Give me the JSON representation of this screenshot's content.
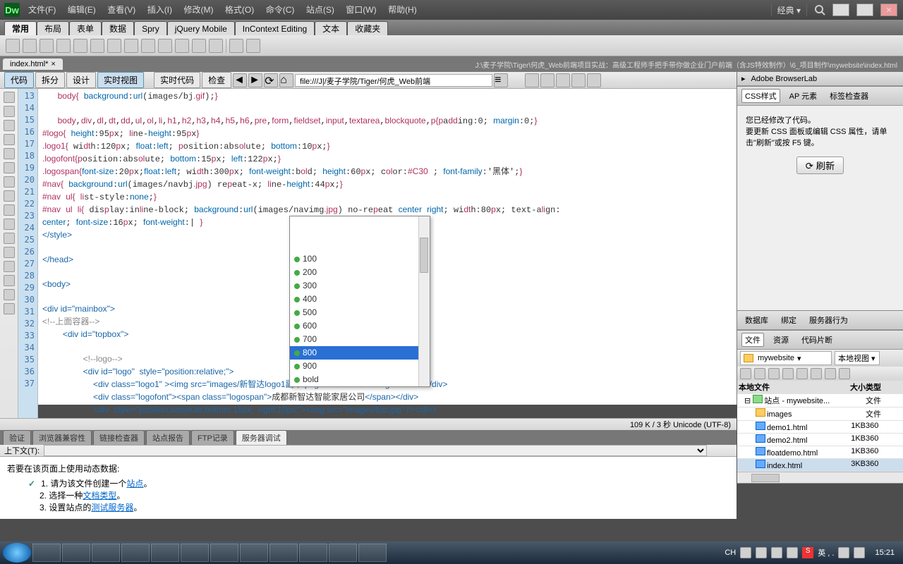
{
  "app": {
    "logo": "Dw",
    "layout_label": "经典"
  },
  "menubar": [
    "文件(F)",
    "编辑(E)",
    "查看(V)",
    "插入(I)",
    "修改(M)",
    "格式(O)",
    "命令(C)",
    "站点(S)",
    "窗口(W)",
    "帮助(H)"
  ],
  "insert_tabs": [
    "常用",
    "布局",
    "表单",
    "数据",
    "Spry",
    "jQuery Mobile",
    "InContext Editing",
    "文本",
    "收藏夹"
  ],
  "file_tab": {
    "name": "index.html*",
    "close": "×",
    "path": "J:\\麦子学院\\Tiger\\何虎_Web前端项目实战：高级工程师手把手带你做企业门户前端（含JS特效制作）\\6_项目制作\\mywebsite\\index.html"
  },
  "view_buttons": {
    "code": "代码",
    "split": "拆分",
    "design": "设计",
    "live": "实时视图",
    "livecode": "实时代码",
    "check": "检查"
  },
  "addr_prefix": "file:///J|/麦子学院/Tiger/何虎_Web前端",
  "code_lines": {
    "start": 13,
    "end": 37,
    "l13": "body{ background:url(images/bj.gif);}",
    "l14": "",
    "l15": "body,div,dl,dt,dd,ul,ol,li,h1,h2,h3,h4,h5,h6,pre,form,fieldset,input,textarea,blockquote,p{padding:0; margin:0;}",
    "l16": "#logo{ height:95px; line-height:95px}",
    "l17": ".logo1{ width:120px; float:left; position:absolute; bottom:10px;}",
    "l18": ".logofont{position:absolute; bottom:15px; left:122px;}",
    "l19": ".logospan{font-size:20px;float:left; width:300px; font-weight:bold; height:60px; color:#C30 ; font-family:'黑体';}",
    "l20": "#nav{ background:url(images/navbj.jpg) repeat-x; line-height:44px;}",
    "l21": "#nav ul{ list-style:none;}",
    "l22a": "#nav ul li{ display:inline-block; background:url(images/navimg.jpg) no-repeat center right; width:80px; text-align:",
    "l22b": "center; font-size:16px; font-weight:| }",
    "l23": "</style>",
    "l24": "",
    "l25": "</head>",
    "l26": "",
    "l27": "<body>",
    "l28": "",
    "l29": "<div id=\"mainbox\">",
    "l30": "<!--上面容器-->",
    "l31": "    <div id=\"topbox\">",
    "l32": "",
    "l33": "        <!--logo-->",
    "l34": "        <div id=\"logo\"  style=\"position:relative;\">",
    "l35": "          <div class=\"logo1\" ><img src=\"images/新智达logo1副本.png\"  width=\"120\" height=\"60\"/></div>",
    "l36": "          <div class=\"logofont\"><span class=\"logospan\">成都新智达智能家居公司</span></div>",
    "l37": "          <div  style=\"position:absolute;bottom:15px;  right:10px;\"><img src=\"images/top.jpg\" /></div>"
  },
  "autocomplete": {
    "options": [
      "100",
      "200",
      "300",
      "400",
      "500",
      "600",
      "700",
      "800",
      "900",
      "bold"
    ],
    "selected": "800"
  },
  "status": "109 K / 3 秒 Unicode (UTF-8)",
  "bottom_tabs": [
    "验证",
    "浏览器兼容性",
    "链接检查器",
    "站点报告",
    "FTP记录",
    "服务器调试"
  ],
  "context_label": "上下文(T):",
  "dynamic": {
    "intro": "若要在该页面上使用动态数据:",
    "s1": "请为该文件创建一个",
    "s1link": "站点",
    "s2": "选择一种",
    "s2link": "文档类型",
    "s3": "设置站点的",
    "s3link": "测试服务器"
  },
  "right": {
    "browserlab_title": "Adobe BrowserLab",
    "css_tabs": {
      "a": "CSS样式",
      "b": "AP 元素",
      "c": "标签检查器"
    },
    "css_msg1": "您已经修改了代码。",
    "css_msg2": "要更新 CSS 面板或编辑 CSS 属性，请单击\"刷新\"或按 F5 键。",
    "refresh": "刷新",
    "db_tabs": {
      "a": "数据库",
      "b": "绑定",
      "c": "服务器行为"
    },
    "file_tabs": {
      "a": "文件",
      "b": "资源",
      "c": "代码片断"
    },
    "site_name": "mywebsite",
    "view_name": "本地视图",
    "cols": {
      "name": "本地文件",
      "size": "大小",
      "type": "类型"
    },
    "tree": [
      {
        "indent": 0,
        "icon": "site",
        "name": "站点 - mywebsite...",
        "size": "",
        "type": "文件"
      },
      {
        "indent": 1,
        "icon": "folder",
        "name": "images",
        "size": "",
        "type": "文件"
      },
      {
        "indent": 1,
        "icon": "html",
        "name": "demo1.html",
        "size": "1KB",
        "type": "360"
      },
      {
        "indent": 1,
        "icon": "html",
        "name": "demo2.html",
        "size": "1KB",
        "type": "360"
      },
      {
        "indent": 1,
        "icon": "html",
        "name": "floatdemo.html",
        "size": "1KB",
        "type": "360"
      },
      {
        "indent": 1,
        "icon": "html",
        "name": "index.html",
        "size": "3KB",
        "type": "360",
        "sel": true
      }
    ]
  },
  "tray": {
    "ime": "CH",
    "extras": "英 , .",
    "time": "15:21"
  }
}
